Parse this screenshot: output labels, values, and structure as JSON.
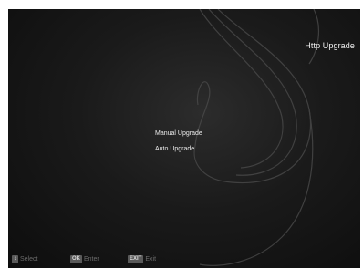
{
  "screen": {
    "title": "Http Upgrade"
  },
  "menu": {
    "items": [
      {
        "label": "Manual Upgrade"
      },
      {
        "label": "Auto Upgrade"
      }
    ]
  },
  "footer": {
    "hints": [
      {
        "key": "↕",
        "label": "Select"
      },
      {
        "key": "OK",
        "label": "Enter"
      },
      {
        "key": "EXIT",
        "label": "Exit"
      }
    ]
  },
  "colors": {
    "background": "#1a1a1a",
    "text": "#f2f2f2",
    "hint_text": "#6a6a6a",
    "key_badge": "#5a5a5a"
  }
}
